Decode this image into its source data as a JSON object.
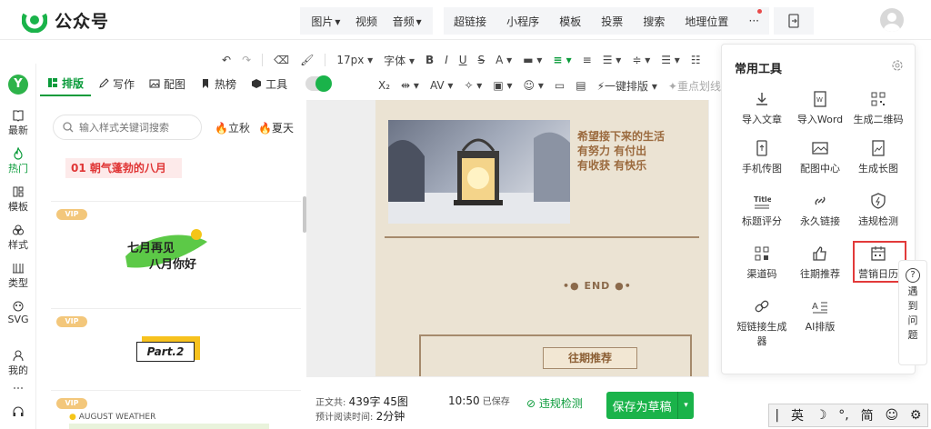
{
  "header": {
    "logo_text": "公众号",
    "media": [
      "图片",
      "视频",
      "音频"
    ],
    "links": [
      "超链接",
      "小程序",
      "模板",
      "投票",
      "搜索",
      "地理位置",
      "···"
    ]
  },
  "leftnav": {
    "items": [
      {
        "label": "最新",
        "icon": "book-icon"
      },
      {
        "label": "热门",
        "icon": "flame-icon"
      },
      {
        "label": "模板",
        "icon": "grid-icon"
      },
      {
        "label": "样式",
        "icon": "palette-icon"
      },
      {
        "label": "类型",
        "icon": "columns-icon"
      },
      {
        "label": "SVG",
        "icon": "svg-icon"
      },
      {
        "label": "我的",
        "icon": "user-icon"
      }
    ]
  },
  "tabs": [
    "排版",
    "写作",
    "配图",
    "热榜",
    "工具"
  ],
  "search": {
    "placeholder": "输入样式关键词搜索",
    "tags": [
      "立秋",
      "夏天"
    ]
  },
  "list": {
    "card1_text": "01 朝气蓬勃的八月",
    "vip": "VIP",
    "card2_line1": "七月再见",
    "card2_line2": "八月你好",
    "card3_text": "Part.2",
    "card4_text": "AUGUST WEATHER"
  },
  "toolbar": {
    "row1": [
      "17px",
      "字体"
    ],
    "row2": [
      "一键排版",
      "重点划线"
    ]
  },
  "article": {
    "lines": [
      "希望接下来的生活",
      "有努力 有付出",
      "有收获 有快乐"
    ],
    "end": "•● END ●•",
    "past": "往期推荐"
  },
  "bottom": {
    "word_label": "正文共:",
    "words": "439字",
    "images": "45图",
    "read_label": "预计阅读时间:",
    "read_time": "2分钟",
    "saved_time": "10:50",
    "saved_label": "已保存",
    "check": "违规检测",
    "save": "保存为草稿"
  },
  "tools": {
    "title": "常用工具",
    "items": [
      {
        "label": "导入文章",
        "icon": "import-icon"
      },
      {
        "label": "导入Word",
        "icon": "word-icon"
      },
      {
        "label": "生成二维码",
        "icon": "qrcode-icon"
      },
      {
        "label": "手机传图",
        "icon": "phone-upload-icon"
      },
      {
        "label": "配图中心",
        "icon": "image-icon"
      },
      {
        "label": "生成长图",
        "icon": "long-image-icon"
      },
      {
        "label": "标题评分",
        "icon": "title-icon"
      },
      {
        "label": "永久链接",
        "icon": "link-icon"
      },
      {
        "label": "违规检测",
        "icon": "shield-icon"
      },
      {
        "label": "渠道码",
        "icon": "channel-qr-icon"
      },
      {
        "label": "往期推荐",
        "icon": "thumb-icon"
      },
      {
        "label": "营销日历",
        "icon": "calendar-icon"
      },
      {
        "label": "短链接生成器",
        "icon": "short-link-icon"
      },
      {
        "label": "AI排版",
        "icon": "ai-layout-icon"
      }
    ]
  },
  "help": {
    "chars": [
      "遇",
      "到",
      "问",
      "题"
    ]
  },
  "ime": {
    "lang": "英",
    "simp": "简"
  },
  "colors": {
    "brand": "#1ab34a",
    "accent_brown": "#9b6a3e",
    "highlight": "#e23a3a"
  }
}
